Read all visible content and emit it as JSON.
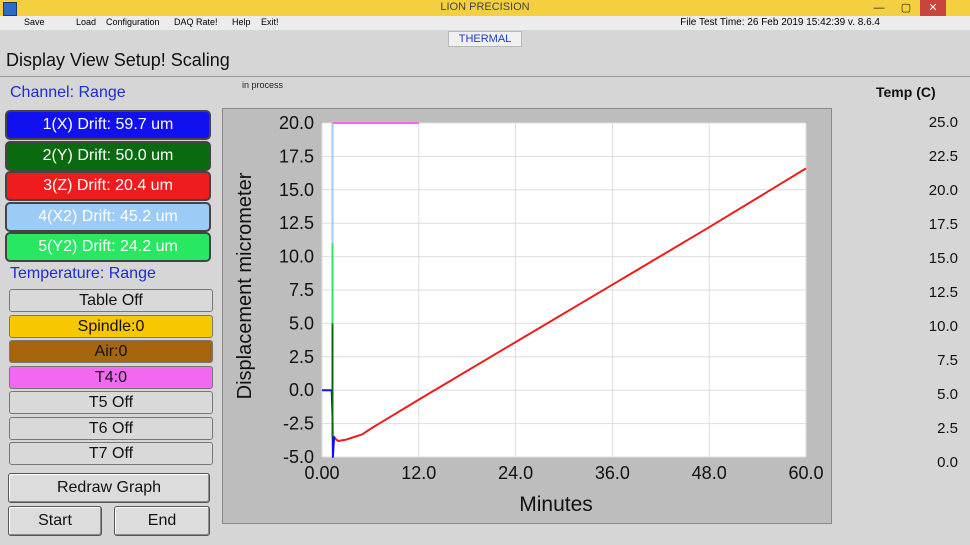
{
  "window": {
    "title": "LION PRECISION",
    "min_glyph": "—",
    "restore_glyph": "▢",
    "close_glyph": "✕"
  },
  "menu": {
    "save": "Save",
    "load": "Load",
    "configuration": "Configuration",
    "daq_rate": "DAQ Rate!",
    "help": "Help",
    "exit": "Exit!",
    "file_test_time": "File Test Time: 26 Feb 2019  15:42:39   v. 8.6.4"
  },
  "mode_label": "THERMAL",
  "subheader": "Display View Setup! Scaling",
  "status": "in process",
  "channel_section": {
    "title": "Channel:  Range",
    "channels": [
      {
        "label": "1(X) Drift: 59.7 um",
        "color": "#1010f0",
        "text_color": "#ffffff"
      },
      {
        "label": "2(Y) Drift: 50.0 um",
        "color": "#0a6a10",
        "text_color": "#ffffff"
      },
      {
        "label": "3(Z) Drift: 20.4 um",
        "color": "#ee1c1c",
        "text_color": "#ffffff"
      },
      {
        "label": "4(X2) Drift: 45.2 um",
        "color": "#9ccbf5",
        "text_color": "#ffffff"
      },
      {
        "label": "5(Y2) Drift: 24.2 um",
        "color": "#27e860",
        "text_color": "#ffffff"
      }
    ]
  },
  "temperature_section": {
    "title": "Temperature: Range",
    "sensors": [
      {
        "label": "Table Off",
        "color": "#d9d9d9"
      },
      {
        "label": "Spindle:0",
        "color": "#f7c800"
      },
      {
        "label": "Air:0",
        "color": "#a5650c"
      },
      {
        "label": "T4:0",
        "color": "#f268f2"
      },
      {
        "label": "T5 Off",
        "color": "#d9d9d9"
      },
      {
        "label": "T6 Off",
        "color": "#d9d9d9"
      },
      {
        "label": "T7 Off",
        "color": "#d9d9d9"
      }
    ]
  },
  "buttons": {
    "redraw": "Redraw Graph",
    "start": "Start",
    "end": "End"
  },
  "temp_axis": {
    "label": "Temp (C)",
    "ticks": [
      "25.0",
      "22.5",
      "20.0",
      "17.5",
      "15.0",
      "12.5",
      "10.0",
      "7.5",
      "5.0",
      "2.5",
      "0.0"
    ]
  },
  "chart_data": {
    "type": "line",
    "xlabel": "Minutes",
    "ylabel": "Displacement micrometer",
    "xlim": [
      0,
      60
    ],
    "ylim": [
      -5,
      20
    ],
    "x_ticks": [
      "0.00",
      "12.0",
      "24.0",
      "36.0",
      "48.0",
      "60.0"
    ],
    "y_ticks": [
      "20.0",
      "17.5",
      "15.0",
      "12.5",
      "10.0",
      "7.5",
      "5.0",
      "2.5",
      "0.0",
      "-2.5",
      "-5.0"
    ],
    "grid": true,
    "series": [
      {
        "color": "#ee1c1c",
        "x": [
          1.6,
          2.0,
          3.0,
          4.0,
          5.0,
          6.0,
          12.0,
          24.0,
          36.0,
          48.0,
          60.0
        ],
        "y": [
          -3.6,
          -3.8,
          -3.7,
          -3.5,
          -3.3,
          -2.9,
          -0.7,
          3.6,
          7.9,
          12.2,
          16.6
        ]
      },
      {
        "color": "#1010f0",
        "x": [
          0.0,
          1.2,
          1.3,
          1.35,
          1.5,
          1.6
        ],
        "y": [
          0.0,
          0.0,
          -2.0,
          -5.0,
          -3.5,
          -3.6
        ]
      },
      {
        "color": "#0a6a10",
        "x": [
          1.3,
          1.3
        ],
        "y": [
          -3.5,
          5.0
        ]
      },
      {
        "color": "#9ccbf5",
        "x": [
          1.3,
          1.3
        ],
        "y": [
          5.0,
          20.0
        ]
      },
      {
        "color": "#27e860",
        "x": [
          1.3,
          1.3
        ],
        "y": [
          5.0,
          11.0
        ]
      },
      {
        "color": "#f268f2",
        "x": [
          1.3,
          12.0
        ],
        "y": [
          20.0,
          20.0
        ]
      }
    ]
  }
}
